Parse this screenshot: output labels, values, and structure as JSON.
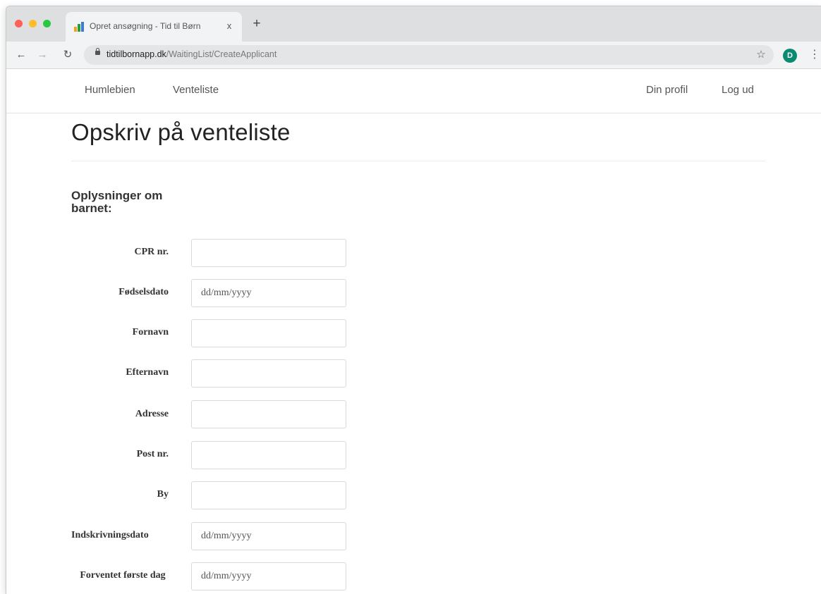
{
  "browser": {
    "tab_title": "Opret ansøgning - Tid til Børn",
    "tab_close": "x",
    "new_tab": "+",
    "url_host": "tidtilbornapp.dk",
    "url_path": "/WaitingList/CreateApplicant",
    "profile_initial": "D",
    "icons": [
      "back-arrow-icon",
      "forward-arrow-icon",
      "reload-icon",
      "lock-icon",
      "star-icon",
      "kebab-menu-icon"
    ]
  },
  "nav": {
    "left": [
      "Humlebien",
      "Venteliste"
    ],
    "right": [
      "Din profil",
      "Log ud"
    ]
  },
  "page": {
    "title": "Opskriv på venteliste",
    "section_title": "Oplysninger om barnet:"
  },
  "form": {
    "fields": [
      {
        "label": "CPR nr.",
        "value": "",
        "placeholder": ""
      },
      {
        "label": "Fødselsdato",
        "value": "",
        "placeholder": "dd/mm/yyyy"
      },
      {
        "label": "Fornavn",
        "value": "",
        "placeholder": ""
      },
      {
        "label": "Efternavn",
        "value": "",
        "placeholder": ""
      },
      {
        "label": "Adresse",
        "value": "",
        "placeholder": ""
      },
      {
        "label": "Post nr.",
        "value": "",
        "placeholder": ""
      },
      {
        "label": "By",
        "value": "",
        "placeholder": ""
      },
      {
        "label": "Indskrivningsdato",
        "value": "",
        "placeholder": "dd/mm/yyyy"
      },
      {
        "label": "Forventet første dag",
        "value": "",
        "placeholder": "dd/mm/yyyy"
      }
    ]
  },
  "colors": {
    "profile_chip": "#0b8a72",
    "tab_strip": "#dedfe1"
  }
}
